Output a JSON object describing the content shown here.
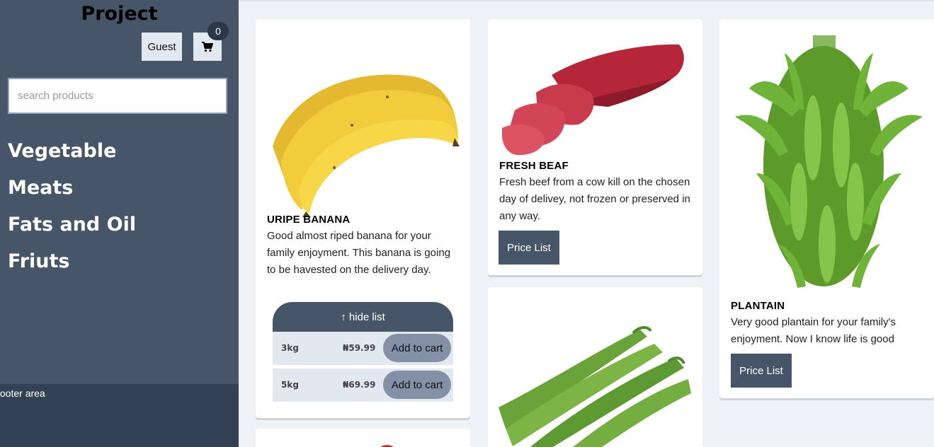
{
  "app": {
    "brand": "Project"
  },
  "header": {
    "guest_label": "Guest",
    "cart_count": "0"
  },
  "search": {
    "placeholder": "search products",
    "value": ""
  },
  "categories": [
    {
      "label": "Vegetable"
    },
    {
      "label": "Meats"
    },
    {
      "label": "Fats and Oil"
    },
    {
      "label": "Friuts"
    }
  ],
  "footer": {
    "text": "footer area"
  },
  "products": [
    {
      "name": "URIPE BANANA",
      "description": "Good almost riped banana for your family enjoyment. This banana is going to be havested on the delivery day.",
      "hide_list_label": "↑ hide list",
      "prices": [
        {
          "weight": "3kg",
          "price": "₦59.99",
          "add_label": "Add to cart"
        },
        {
          "weight": "5kg",
          "price": "₦69.99",
          "add_label": "Add to cart"
        }
      ]
    },
    {
      "name": "FRESH BEAF",
      "description": "Fresh beef from a cow kill on the chosen day of delivey, not frozen or preserved in any way.",
      "button_label": "Price List"
    },
    {
      "name": "PLANTAIN",
      "description": "Very good plantain for your family's enjoyment. Now I know life is good",
      "button_label": "Price List"
    }
  ],
  "icons": {
    "cart": "cart-icon"
  },
  "colors": {
    "sidebar": "#475569",
    "footer": "#334155",
    "accent_button": "#475569",
    "background": "#eef1f5"
  }
}
